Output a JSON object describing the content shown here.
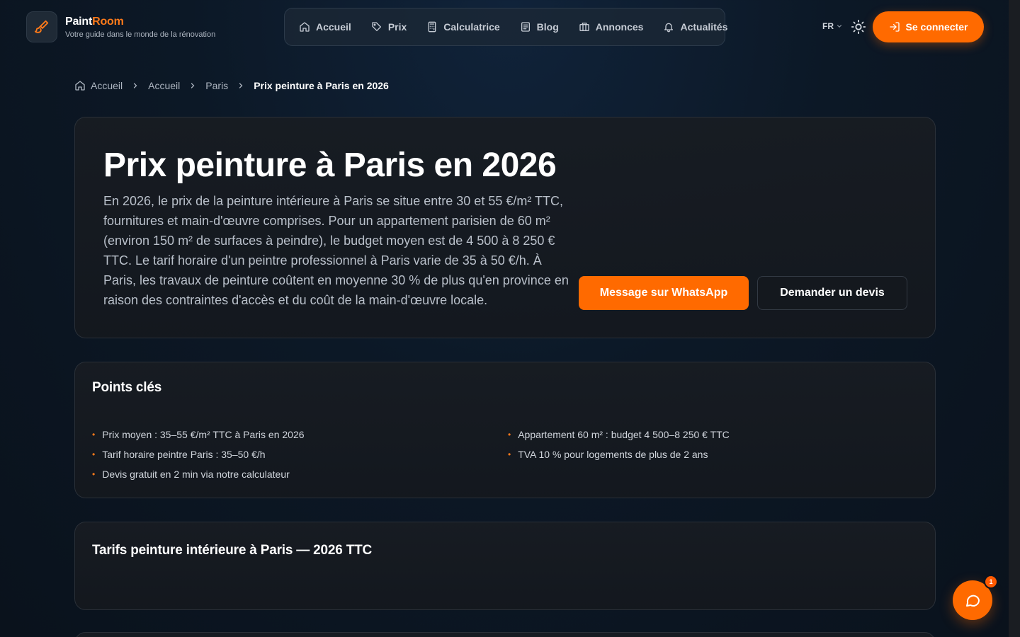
{
  "brand": {
    "name_part1": "Paint",
    "name_part2": "Room",
    "tagline": "Votre guide dans le monde de la rénovation"
  },
  "nav": {
    "items": [
      {
        "label": "Accueil",
        "icon": "home-icon"
      },
      {
        "label": "Prix",
        "icon": "tag-icon"
      },
      {
        "label": "Calculatrice",
        "icon": "calculator-icon"
      },
      {
        "label": "Blog",
        "icon": "newspaper-icon"
      },
      {
        "label": "Annonces",
        "icon": "building-icon"
      },
      {
        "label": "Actualités",
        "icon": "bell-icon"
      }
    ],
    "lang": "FR",
    "login_label": "Se connecter"
  },
  "breadcrumb": {
    "items": [
      "Accueil",
      "Accueil",
      "Paris"
    ],
    "current": "Prix peinture à Paris en 2026"
  },
  "hero": {
    "title": "Prix peinture à Paris en 2026",
    "intro": "En 2026, le prix de la peinture intérieure à Paris se situe entre 30 et 55 €/m² TTC, fournitures et main-d'œuvre comprises. Pour un appartement parisien de 60 m² (environ 150 m² de surfaces à peindre), le budget moyen est de 4 500 à 8 250 € TTC. Le tarif horaire d'un peintre professionnel à Paris varie de 35 à 50 €/h. À Paris, les travaux de peinture coûtent en moyenne 30 % de plus qu'en province en raison des contraintes d'accès et du coût de la main-d'œuvre locale.",
    "whatsapp_label": "Message sur WhatsApp",
    "quote_label": "Demander un devis"
  },
  "keypoints": {
    "title": "Points clés",
    "left": [
      "Prix moyen : 35–55 €/m² TTC à Paris en 2026",
      "Tarif horaire peintre Paris : 35–50 €/h",
      "Devis gratuit en 2 min via notre calculateur"
    ],
    "right": [
      "Appartement 60 m² : budget 4 500–8 250 € TTC",
      "TVA 10 % pour logements de plus de 2 ans"
    ]
  },
  "tarifs": {
    "title": "Tarifs peinture intérieure à Paris — 2026 TTC"
  },
  "chat": {
    "badge": "1"
  },
  "colors": {
    "accent": "#ff6a00",
    "background": "#0c1826"
  }
}
